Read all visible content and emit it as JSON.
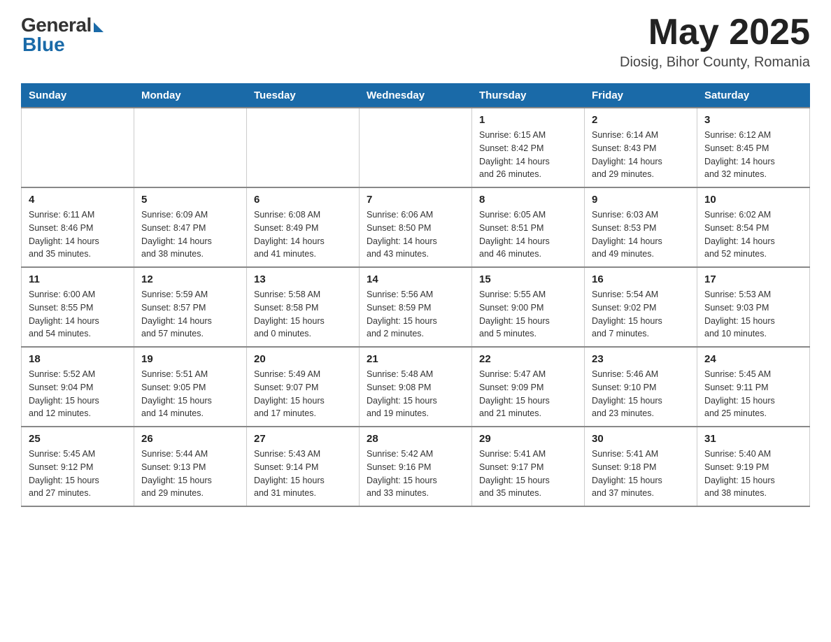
{
  "header": {
    "logo_general": "General",
    "logo_blue": "Blue",
    "month_year": "May 2025",
    "location": "Diosig, Bihor County, Romania"
  },
  "weekdays": [
    "Sunday",
    "Monday",
    "Tuesday",
    "Wednesday",
    "Thursday",
    "Friday",
    "Saturday"
  ],
  "weeks": [
    [
      {
        "day": "",
        "info": ""
      },
      {
        "day": "",
        "info": ""
      },
      {
        "day": "",
        "info": ""
      },
      {
        "day": "",
        "info": ""
      },
      {
        "day": "1",
        "info": "Sunrise: 6:15 AM\nSunset: 8:42 PM\nDaylight: 14 hours\nand 26 minutes."
      },
      {
        "day": "2",
        "info": "Sunrise: 6:14 AM\nSunset: 8:43 PM\nDaylight: 14 hours\nand 29 minutes."
      },
      {
        "day": "3",
        "info": "Sunrise: 6:12 AM\nSunset: 8:45 PM\nDaylight: 14 hours\nand 32 minutes."
      }
    ],
    [
      {
        "day": "4",
        "info": "Sunrise: 6:11 AM\nSunset: 8:46 PM\nDaylight: 14 hours\nand 35 minutes."
      },
      {
        "day": "5",
        "info": "Sunrise: 6:09 AM\nSunset: 8:47 PM\nDaylight: 14 hours\nand 38 minutes."
      },
      {
        "day": "6",
        "info": "Sunrise: 6:08 AM\nSunset: 8:49 PM\nDaylight: 14 hours\nand 41 minutes."
      },
      {
        "day": "7",
        "info": "Sunrise: 6:06 AM\nSunset: 8:50 PM\nDaylight: 14 hours\nand 43 minutes."
      },
      {
        "day": "8",
        "info": "Sunrise: 6:05 AM\nSunset: 8:51 PM\nDaylight: 14 hours\nand 46 minutes."
      },
      {
        "day": "9",
        "info": "Sunrise: 6:03 AM\nSunset: 8:53 PM\nDaylight: 14 hours\nand 49 minutes."
      },
      {
        "day": "10",
        "info": "Sunrise: 6:02 AM\nSunset: 8:54 PM\nDaylight: 14 hours\nand 52 minutes."
      }
    ],
    [
      {
        "day": "11",
        "info": "Sunrise: 6:00 AM\nSunset: 8:55 PM\nDaylight: 14 hours\nand 54 minutes."
      },
      {
        "day": "12",
        "info": "Sunrise: 5:59 AM\nSunset: 8:57 PM\nDaylight: 14 hours\nand 57 minutes."
      },
      {
        "day": "13",
        "info": "Sunrise: 5:58 AM\nSunset: 8:58 PM\nDaylight: 15 hours\nand 0 minutes."
      },
      {
        "day": "14",
        "info": "Sunrise: 5:56 AM\nSunset: 8:59 PM\nDaylight: 15 hours\nand 2 minutes."
      },
      {
        "day": "15",
        "info": "Sunrise: 5:55 AM\nSunset: 9:00 PM\nDaylight: 15 hours\nand 5 minutes."
      },
      {
        "day": "16",
        "info": "Sunrise: 5:54 AM\nSunset: 9:02 PM\nDaylight: 15 hours\nand 7 minutes."
      },
      {
        "day": "17",
        "info": "Sunrise: 5:53 AM\nSunset: 9:03 PM\nDaylight: 15 hours\nand 10 minutes."
      }
    ],
    [
      {
        "day": "18",
        "info": "Sunrise: 5:52 AM\nSunset: 9:04 PM\nDaylight: 15 hours\nand 12 minutes."
      },
      {
        "day": "19",
        "info": "Sunrise: 5:51 AM\nSunset: 9:05 PM\nDaylight: 15 hours\nand 14 minutes."
      },
      {
        "day": "20",
        "info": "Sunrise: 5:49 AM\nSunset: 9:07 PM\nDaylight: 15 hours\nand 17 minutes."
      },
      {
        "day": "21",
        "info": "Sunrise: 5:48 AM\nSunset: 9:08 PM\nDaylight: 15 hours\nand 19 minutes."
      },
      {
        "day": "22",
        "info": "Sunrise: 5:47 AM\nSunset: 9:09 PM\nDaylight: 15 hours\nand 21 minutes."
      },
      {
        "day": "23",
        "info": "Sunrise: 5:46 AM\nSunset: 9:10 PM\nDaylight: 15 hours\nand 23 minutes."
      },
      {
        "day": "24",
        "info": "Sunrise: 5:45 AM\nSunset: 9:11 PM\nDaylight: 15 hours\nand 25 minutes."
      }
    ],
    [
      {
        "day": "25",
        "info": "Sunrise: 5:45 AM\nSunset: 9:12 PM\nDaylight: 15 hours\nand 27 minutes."
      },
      {
        "day": "26",
        "info": "Sunrise: 5:44 AM\nSunset: 9:13 PM\nDaylight: 15 hours\nand 29 minutes."
      },
      {
        "day": "27",
        "info": "Sunrise: 5:43 AM\nSunset: 9:14 PM\nDaylight: 15 hours\nand 31 minutes."
      },
      {
        "day": "28",
        "info": "Sunrise: 5:42 AM\nSunset: 9:16 PM\nDaylight: 15 hours\nand 33 minutes."
      },
      {
        "day": "29",
        "info": "Sunrise: 5:41 AM\nSunset: 9:17 PM\nDaylight: 15 hours\nand 35 minutes."
      },
      {
        "day": "30",
        "info": "Sunrise: 5:41 AM\nSunset: 9:18 PM\nDaylight: 15 hours\nand 37 minutes."
      },
      {
        "day": "31",
        "info": "Sunrise: 5:40 AM\nSunset: 9:19 PM\nDaylight: 15 hours\nand 38 minutes."
      }
    ]
  ]
}
